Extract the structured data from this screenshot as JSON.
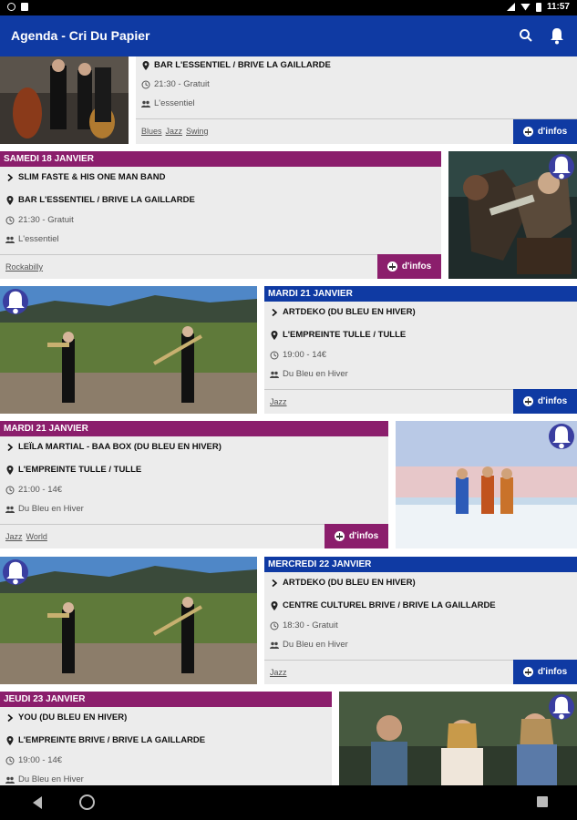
{
  "status_bar": {
    "time": "11:57"
  },
  "app_bar": {
    "title": "Agenda - Cri Du Papier"
  },
  "more_info_label": "d'infos",
  "events": [
    {
      "date": "",
      "title": "",
      "venue": "BAR L'ESSENTIEL / BRIVE LA GAILLARDE",
      "time_price": "21:30 - Gratuit",
      "organizer": "L'essentiel",
      "tags": [
        "Blues",
        "Jazz",
        "Swing"
      ],
      "accent": "#0f3aa3"
    },
    {
      "date": "SAMEDI 18 JANVIER",
      "title": "SLIM FASTE & HIS ONE MAN BAND",
      "venue": "BAR L'ESSENTIEL / BRIVE LA GAILLARDE",
      "time_price": "21:30 - Gratuit",
      "organizer": "L'essentiel",
      "tags": [
        "Rockabilly"
      ],
      "accent": "#8b1e6c"
    },
    {
      "date": "MARDI 21 JANVIER",
      "title": "ARTDEKO (DU BLEU EN HIVER)",
      "venue": "L'EMPREINTE TULLE / TULLE",
      "time_price": "19:00 - 14€",
      "organizer": "Du Bleu en Hiver",
      "tags": [
        "Jazz"
      ],
      "accent": "#0f3aa3"
    },
    {
      "date": "MARDI 21 JANVIER",
      "title": "LEÏLA MARTIAL - BAA BOX (DU BLEU EN HIVER)",
      "venue": "L'EMPREINTE TULLE / TULLE",
      "time_price": "21:00 - 14€",
      "organizer": "Du Bleu en Hiver",
      "tags": [
        "Jazz",
        "World"
      ],
      "accent": "#8b1e6c"
    },
    {
      "date": "MERCREDI 22 JANVIER",
      "title": "ARTDEKO (DU BLEU EN HIVER)",
      "venue": "CENTRE CULTUREL BRIVE / BRIVE LA GAILLARDE",
      "time_price": "18:30 - Gratuit",
      "organizer": "Du Bleu en Hiver",
      "tags": [
        "Jazz"
      ],
      "accent": "#0f3aa3"
    },
    {
      "date": "JEUDI 23 JANVIER",
      "title": "YOU (DU BLEU EN HIVER)",
      "venue": "L'EMPREINTE BRIVE / BRIVE LA GAILLARDE",
      "time_price": "19:00 - 14€",
      "organizer": "Du Bleu en Hiver",
      "tags": [],
      "accent": "#8b1e6c"
    }
  ]
}
